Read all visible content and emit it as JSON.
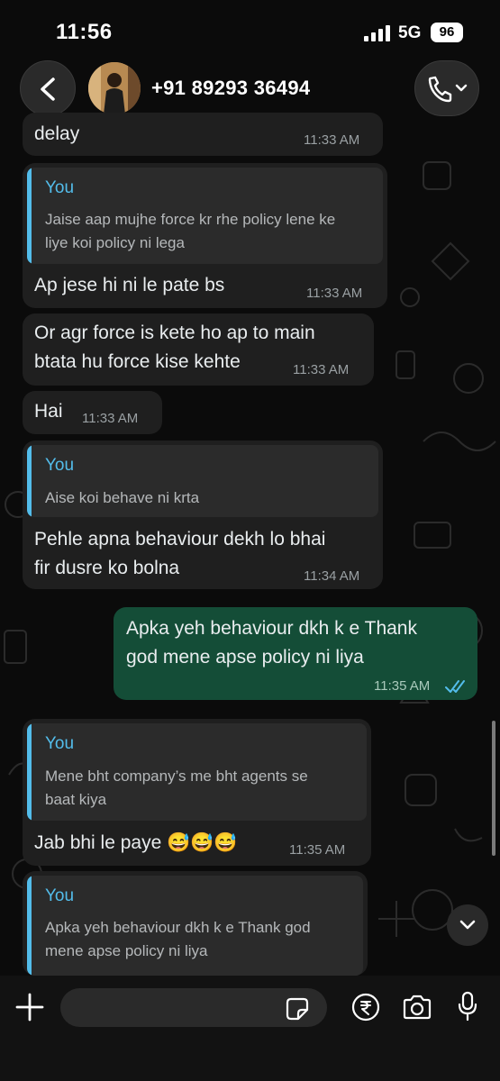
{
  "status_bar": {
    "time": "11:56",
    "network": "5G",
    "battery": "96"
  },
  "header": {
    "contact_name": "+91 89293 36494"
  },
  "messages": [
    {
      "text": "delay",
      "time": "11:33 AM"
    },
    {
      "quote_author": "You",
      "quote_text": [
        "Jaise aap mujhe force kr rhe policy lene ke",
        "liye koi policy ni lega"
      ],
      "text": "Ap jese hi ni le pate bs",
      "time": "11:33 AM"
    },
    {
      "text": [
        "Or agr force is kete ho ap to main",
        "btata hu force kise kehte"
      ],
      "time": "11:33 AM"
    },
    {
      "text": "Hai",
      "time": "11:33 AM"
    },
    {
      "quote_author": "You",
      "quote_text": [
        "Aise koi behave ni krta"
      ],
      "text": [
        "Pehle apna behaviour dekh lo bhai",
        "fir dusre ko bolna"
      ],
      "time": "11:34 AM"
    },
    {
      "text": [
        "Apka yeh behaviour dkh k e Thank",
        "god mene apse policy ni liya"
      ],
      "time": "11:35 AM",
      "outgoing": true
    },
    {
      "quote_author": "You",
      "quote_text": [
        "Mene bht company’s me bht agents se",
        "baat kiya"
      ],
      "text": "Jab bhi le paye 😅😅😅",
      "time": "11:35 AM"
    },
    {
      "quote_author": "You",
      "quote_text": [
        "Apka yeh behaviour dkh k e Thank god",
        "mene apse policy ni liya"
      ]
    }
  ],
  "input": {
    "placeholder": ""
  },
  "colors": {
    "background": "#0b0b0b",
    "incoming_bubble": "#1f1f1f",
    "outgoing_bubble": "#144d37",
    "quote_accent": "#53bdeb",
    "read_ticks": "#53bdeb"
  },
  "icons": [
    "back-icon",
    "phone-icon",
    "chevron-down-icon",
    "plus-icon",
    "sticker-icon",
    "rupee-icon",
    "camera-icon",
    "mic-icon"
  ]
}
